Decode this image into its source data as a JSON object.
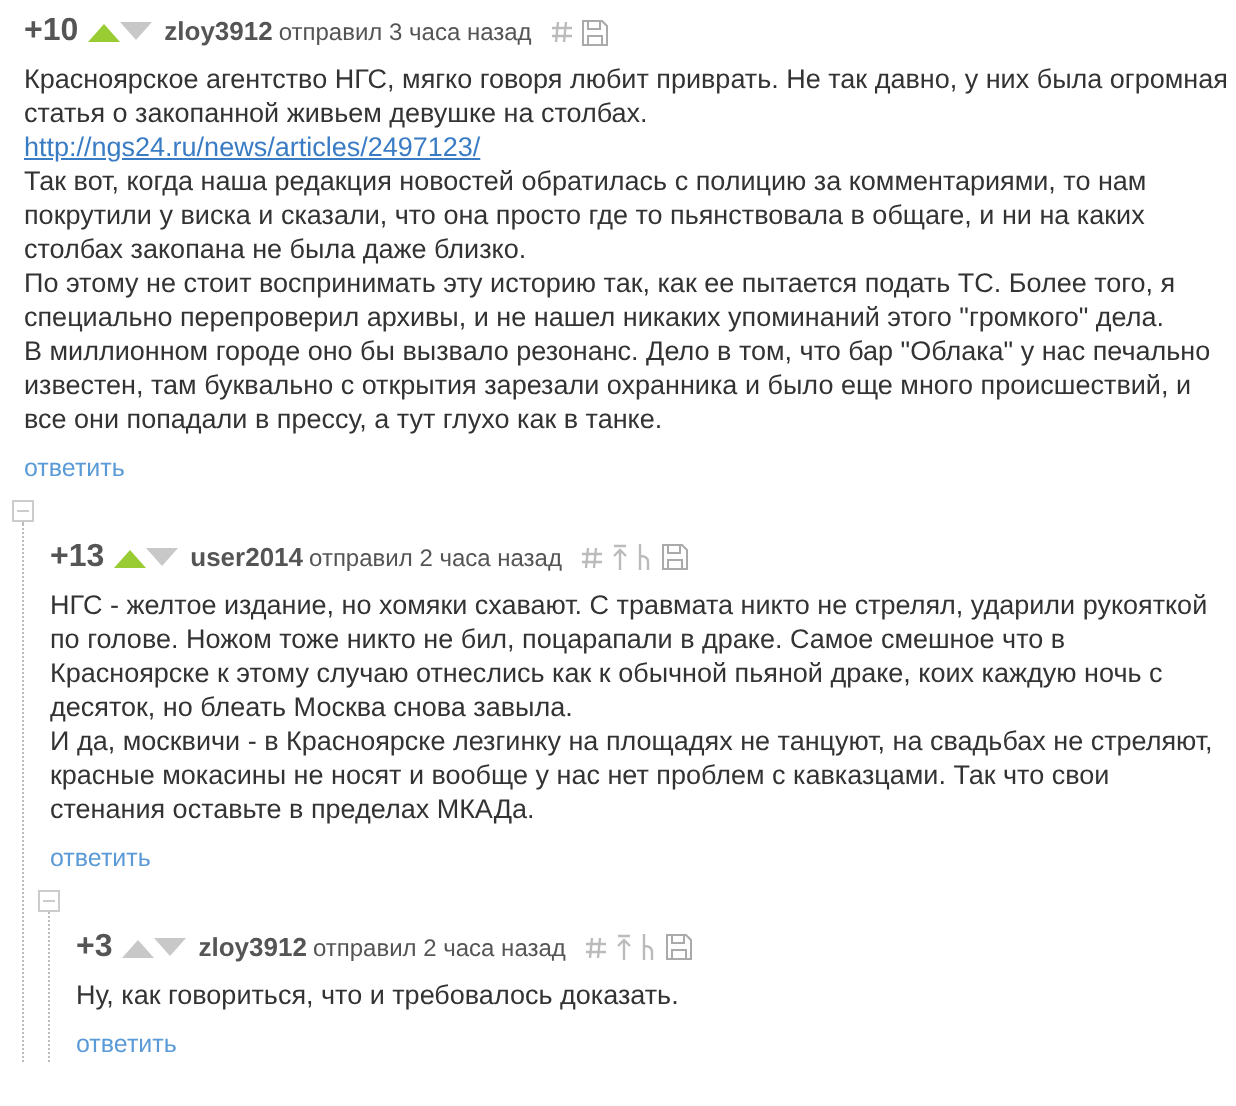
{
  "comments": [
    {
      "score": "+10",
      "upvoted": true,
      "author": "zloy3912",
      "posted": "отправил 3 часа назад",
      "body": [
        {
          "kind": "text",
          "text": "Красноярское агентство НГС, мягко говоря любит приврать. Не так давно, у них была огромная статья о закопанной живьем девушке на столбах."
        },
        {
          "kind": "link",
          "text": "http://ngs24.ru/news/articles/2497123/"
        },
        {
          "kind": "text",
          "text": "Так вот, когда наша редакция новостей обратилась с полицию за комментариями, то нам покрутили у виска и сказали, что она просто где то пьянствовала в общаге, и ни на каких столбах закопана не была даже близко."
        },
        {
          "kind": "text",
          "text": "По этому не стоит воспринимать эту историю так, как ее пытается подать ТС. Более того, я специально перепроверил архивы, и не нашел никаких упоминаний этого \"громкого\" дела."
        },
        {
          "kind": "text",
          "text": "В миллионном городе оно бы вызвало резонанс. Дело в том, что бар \"Облака\" у нас печально известен, там буквально с открытия зарезали охранника и было еще много происшествий, и все они попадали в прессу, а тут глухо как в танке."
        }
      ],
      "reply": "ответить",
      "children": [
        {
          "score": "+13",
          "upvoted": true,
          "author": "user2014",
          "posted": "отправил 2 часа назад",
          "body": [
            {
              "kind": "text",
              "text": "НГС - желтое издание, но хомяки схавают. С травмата никто не стрелял, ударили рукояткой по голове. Ножом тоже никто не бил, поцарапали в драке. Самое смешное что в Красноярске к этому случаю отнеслись как к обычной пьяной драке, коих каждую ночь с десяток, но блеать Москва снова завыла."
            },
            {
              "kind": "text",
              "text": "И да, москвичи - в Красноярске лезгинку на площадях не танцуют, на свадьбах не стреляют, красные мокасины не носят и вообще у нас нет проблем с кавказцами. Так что свои стенания оставьте в пределах МКАДа."
            }
          ],
          "reply": "ответить",
          "children": [
            {
              "score": "+3",
              "upvoted": false,
              "author": "zloy3912",
              "posted": "отправил 2 часа назад",
              "body": [
                {
                  "kind": "text",
                  "text": "Ну, как говориться, что и требовалось доказать."
                }
              ],
              "reply": "ответить"
            }
          ]
        }
      ]
    }
  ]
}
